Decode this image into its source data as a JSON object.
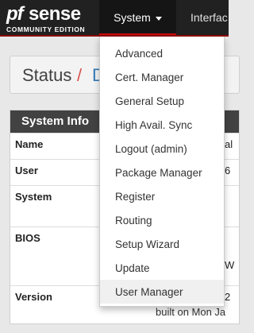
{
  "brand": {
    "name_pf": "pf",
    "name_sense": "sense",
    "tagline": "COMMUNITY EDITION"
  },
  "nav": {
    "system_label": "System",
    "interfaces_label": "Interfac"
  },
  "breadcrumb": {
    "status": "Status",
    "separator": "/",
    "current_partial": "D"
  },
  "panel": {
    "title": "System Info",
    "rows": [
      {
        "label": "Name",
        "value": "al"
      },
      {
        "label": "User",
        "value": "6"
      },
      {
        "label": "System",
        "value": ""
      },
      {
        "label": "BIOS",
        "value": ""
      },
      {
        "label": "Version",
        "value": ""
      }
    ],
    "built_text": "built on Mon Ja"
  },
  "bios_partial": "W",
  "version_partial": "2",
  "system_menu": {
    "items": [
      "Advanced",
      "Cert. Manager",
      "General Setup",
      "High Avail. Sync",
      "Logout (admin)",
      "Package Manager",
      "Register",
      "Routing",
      "Setup Wizard",
      "Update",
      "User Manager"
    ],
    "hovered": "User Manager"
  },
  "colors": {
    "navbar": "#212121",
    "accent_red": "#c40d0d",
    "link_blue": "#337ab7",
    "panel_head": "#424242"
  }
}
